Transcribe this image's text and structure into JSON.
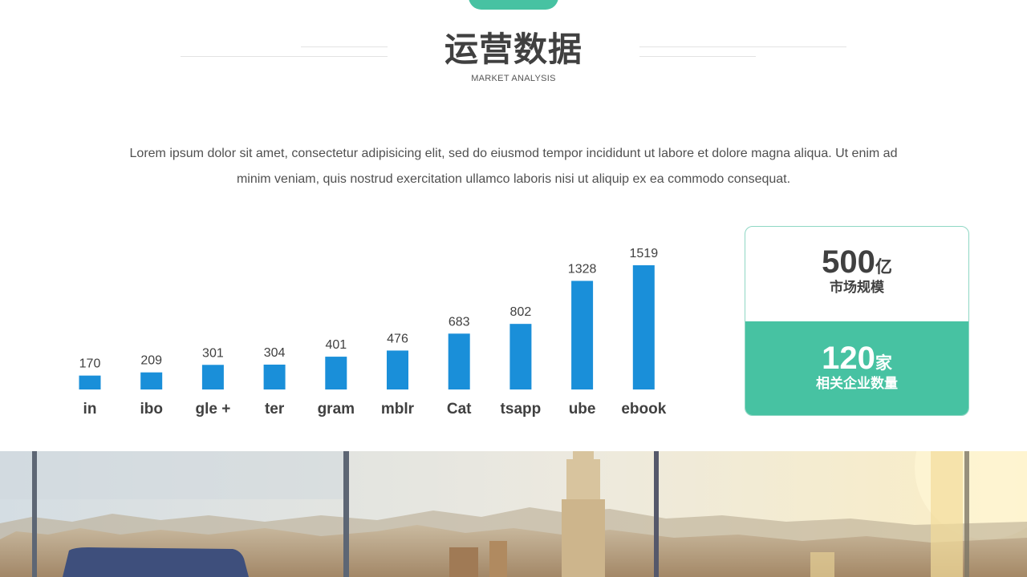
{
  "header": {
    "title": "运营数据",
    "subtitle": "MARKET ANALYSIS"
  },
  "intro": {
    "line1": "Lorem ipsum dolor sit amet, consectetur adipisicing elit, sed do eiusmod tempor incididunt ut labore et dolore magna aliqua. Ut enim ad",
    "line2": "minim veniam, quis nostrud exercitation ullamco laboris nisi ut aliquip ex ea commodo consequat."
  },
  "chart_data": {
    "type": "bar",
    "categories": [
      "in",
      "ibo",
      "gle +",
      "ter",
      "gram",
      "mblr",
      "Cat",
      "tsapp",
      "ube",
      "ebook"
    ],
    "values": [
      170,
      209,
      301,
      304,
      401,
      476,
      683,
      802,
      1328,
      1519
    ],
    "bar_color": "#1a8fd9",
    "ylim": [
      0,
      1519
    ]
  },
  "stats": {
    "market": {
      "value": "500",
      "unit": "亿",
      "label": "市场规模"
    },
    "companies": {
      "value": "120",
      "unit": "家",
      "label": "相关企业数量"
    }
  },
  "colors": {
    "accent": "#47c2a2",
    "bar": "#1a8fd9",
    "text": "#404040"
  }
}
